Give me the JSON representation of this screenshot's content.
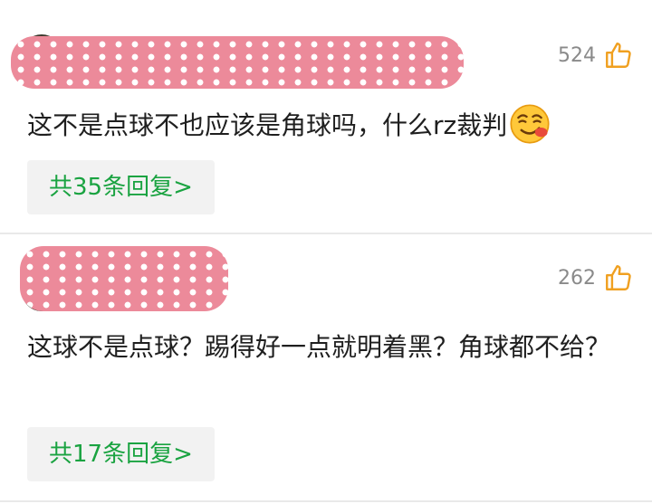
{
  "comments": [
    {
      "likes": "524",
      "text": "这不是点球不也应该是角球吗，什么rz裁判",
      "emoji": "smirk-emoji",
      "reply_label": "共35条回复>"
    },
    {
      "likes": "262",
      "text": "这球不是点球？踢得好一点就明着黑？角球都不给？",
      "reply_label": "共17条回复>"
    }
  ],
  "colors": {
    "reply_text": "#1aa341",
    "reply_bg": "#f2f2f2",
    "like_count": "#8a8a8a",
    "thumb_icon": "#f0a020",
    "censor_blob": "#ec8a9a"
  },
  "icons": [
    "thumbs-up-icon",
    "smirk-emoji"
  ]
}
